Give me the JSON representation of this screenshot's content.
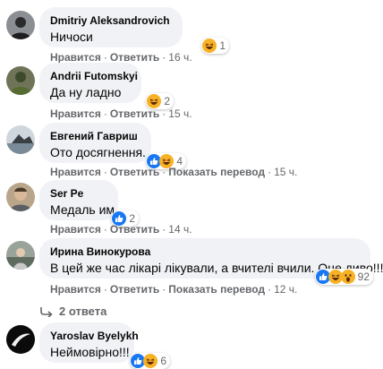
{
  "comments": [
    {
      "author": "Dmitriy Aleksandrovich",
      "text": "Ничоси",
      "reaction_count": "1",
      "reactions": [
        "haha-icon"
      ],
      "like_label": "Нравится",
      "reply_label": "Ответить",
      "translate_label": "",
      "time": "16 ч."
    },
    {
      "author": "Andrii Futomskyi",
      "text": "Да ну ладно",
      "reaction_count": "2",
      "reactions": [
        "haha-icon"
      ],
      "like_label": "Нравится",
      "reply_label": "Ответить",
      "translate_label": "",
      "time": "15 ч."
    },
    {
      "author": "Евгений Гавриш",
      "text": "Ото досягнення.",
      "reaction_count": "4",
      "reactions": [
        "like-icon",
        "haha-icon"
      ],
      "like_label": "Нравится",
      "reply_label": "Ответить",
      "translate_label": "Показать перевод",
      "time": "15 ч."
    },
    {
      "author": "Ser Pe",
      "text": "Медаль им",
      "reaction_count": "2",
      "reactions": [
        "like-icon"
      ],
      "like_label": "Нравится",
      "reply_label": "Ответить",
      "translate_label": "",
      "time": "14 ч."
    },
    {
      "author": "Ирина Винокурова",
      "text": "В цей же час лікарі лікували, а вчителі вчили. Оце диво!!!",
      "reaction_count": "92",
      "reactions": [
        "like-icon",
        "haha-icon",
        "wow-icon"
      ],
      "like_label": "Нравится",
      "reply_label": "Ответить",
      "translate_label": "Показать перевод",
      "time": "12 ч."
    },
    {
      "author": "Yaroslav Byelykh",
      "text": "Неймовірно!!!",
      "reaction_count": "6",
      "reactions": [
        "like-icon",
        "haha-icon"
      ],
      "like_label": "",
      "reply_label": "",
      "translate_label": "",
      "time": ""
    }
  ],
  "replies_label": "2 ответа",
  "dot": "·",
  "colors": {
    "bubble": "#f0f2f5",
    "meta_text": "#65676b",
    "like_blue": "#1877f2",
    "haha_yellow": "#f7b125"
  }
}
